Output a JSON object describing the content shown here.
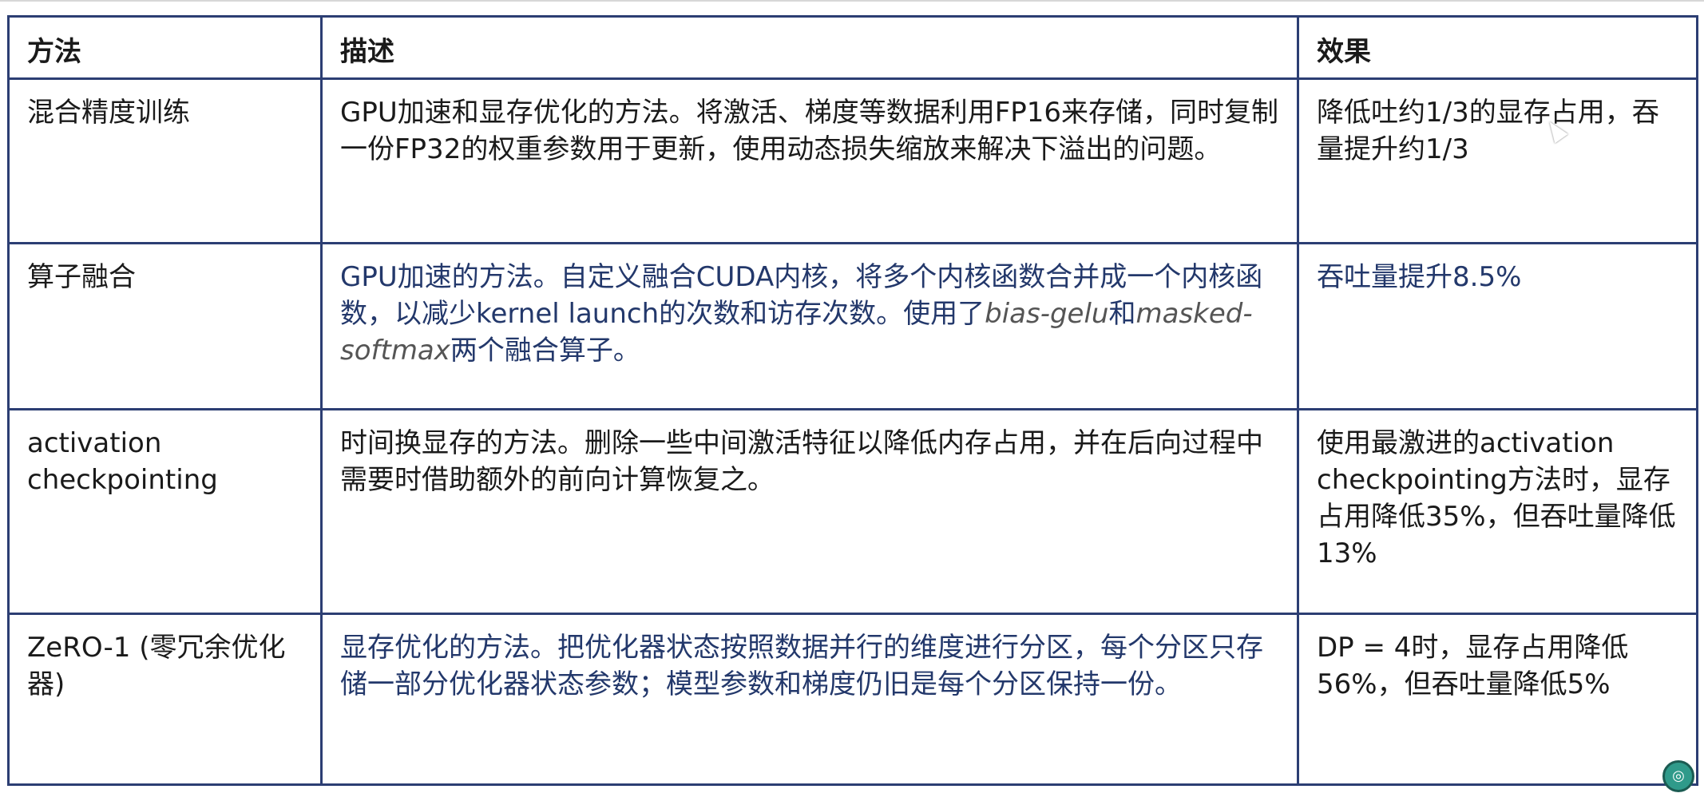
{
  "table": {
    "headers": [
      "方法",
      "描述",
      "效果"
    ],
    "rows": [
      {
        "method": "混合精度训练",
        "description": "GPU加速和显存优化的方法。将激活、梯度等数据利用FP16来存储，同时复制一份FP32的权重参数用于更新，使用动态损失缩放来解决下溢出的问题。",
        "effect": "降低吐约1/3的显存占用，吞量提升约1/3"
      },
      {
        "method": "算子融合",
        "description_parts": {
          "before": "GPU加速的方法。自定义融合CUDA内核，将多个内核函数合并成一个内核函数，以减少kernel launch的次数和访存次数。使用了",
          "term1": "bias-gelu",
          "middle": "和",
          "term2": "masked-softmax",
          "after": "两个融合算子。"
        },
        "effect": "吞吐量提升8.5%"
      },
      {
        "method": "activation checkpointing",
        "description": "时间换显存的方法。删除一些中间激活特征以降低内存占用，并在后向过程中需要时借助额外的前向计算恢复之。",
        "effect": "使用最激进的activation checkpointing方法时，显存占用降低35%，但吞吐量降低13%"
      },
      {
        "method": "ZeRO-1 (零冗余优化器)",
        "description": "显存优化的方法。把优化器状态按照数据并行的维度进行分区，每个分区只存储一部分优化器状态参数；模型参数和梯度仍旧是每个分区保持一份。",
        "effect": "DP = 4时，显存占用降低56%，但吞吐量降低5%"
      }
    ]
  }
}
